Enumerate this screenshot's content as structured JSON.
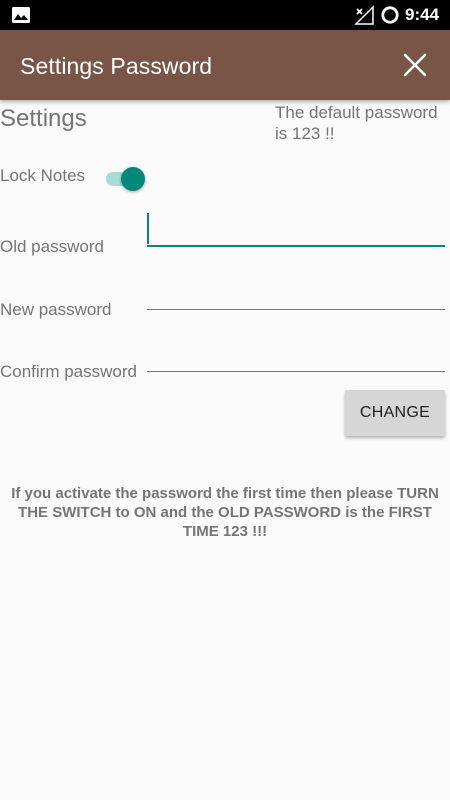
{
  "status_bar": {
    "time": "9:44",
    "icons": [
      "image-icon",
      "no-signal-icon",
      "battery-ring-icon"
    ]
  },
  "toolbar": {
    "title": "Settings Password",
    "close_icon": "close-icon",
    "background_color": "#795548"
  },
  "content": {
    "heading": "Settings",
    "default_note": "The default password is 123 !!",
    "lock_notes": {
      "label": "Lock Notes",
      "switch_state": "on",
      "accent_color": "#00897b"
    },
    "fields": [
      {
        "label": "Old password",
        "value": "",
        "focused": true
      },
      {
        "label": "New password",
        "value": "",
        "focused": false
      },
      {
        "label": "Confirm password",
        "value": "",
        "focused": false
      }
    ],
    "change_button": "CHANGE",
    "info_text": "If you activate the password the first time then please TURN THE SWITCH to ON and the OLD PASSWORD is the FIRST TIME 123 !!!"
  }
}
